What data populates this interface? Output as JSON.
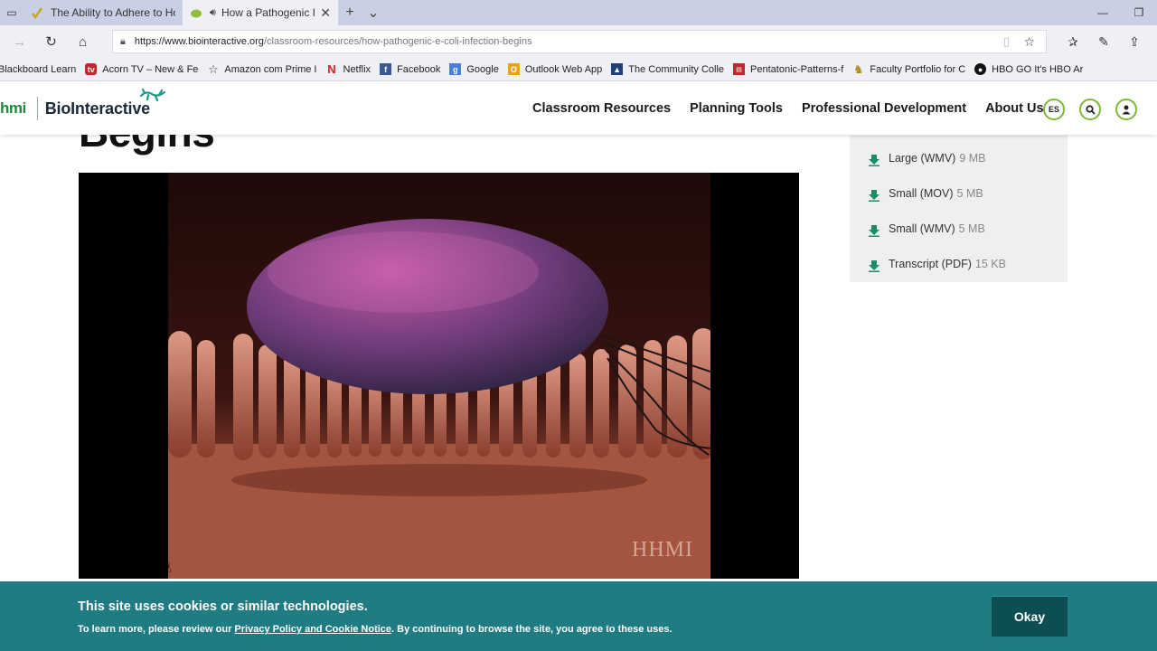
{
  "browser": {
    "tabs": [
      {
        "title": "The Ability to Adhere to Ho",
        "active": false
      },
      {
        "title": "How a Pathogenic I",
        "active": true
      }
    ],
    "url_host": "https://www.biointeractive.org",
    "url_path": "/classroom-resources/how-pathogenic-e-coli-infection-begins",
    "bookmarks": [
      {
        "label": "Blackboard Learn",
        "icon": "blackboard-icon",
        "color": ""
      },
      {
        "label": "Acorn TV – New & Fe",
        "icon": "acorn-tv-icon",
        "color": "#c0282d"
      },
      {
        "label": "Amazon com  Prime I",
        "icon": "star-icon",
        "color": ""
      },
      {
        "label": "Netflix",
        "icon": "netflix-icon",
        "color": "#d81f26"
      },
      {
        "label": "Facebook",
        "icon": "facebook-icon",
        "color": "#3b5998"
      },
      {
        "label": "Google",
        "icon": "google-icon",
        "color": "#4a7fd8"
      },
      {
        "label": "Outlook Web App",
        "icon": "outlook-icon",
        "color": "#e8a317"
      },
      {
        "label": "The Community Colle",
        "icon": "college-icon",
        "color": "#1d3f7a"
      },
      {
        "label": "Pentatonic-Patterns-f",
        "icon": "pdf-icon",
        "color": "#c0282d"
      },
      {
        "label": "Faculty Portfolio for C",
        "icon": "portfolio-icon",
        "color": "#b68a1a"
      },
      {
        "label": "HBO GO  It's HBO  Ar",
        "icon": "hbo-icon",
        "color": "#111111"
      }
    ]
  },
  "site": {
    "logo_hhmi": "hmi",
    "logo_name": "BioInteractive",
    "nav": [
      "Classroom Resources",
      "Planning Tools",
      "Professional Development",
      "About Us"
    ],
    "lang_button": "ES",
    "accent_color": "#7eb83a"
  },
  "page": {
    "title_fragment": "Begins",
    "video_watermark": "HHMI",
    "downloads": [
      {
        "label": "Large (WMV)",
        "size": "9 MB"
      },
      {
        "label": "Small (MOV)",
        "size": "5 MB"
      },
      {
        "label": "Small (WMV)",
        "size": "5 MB"
      },
      {
        "label": "Transcript (PDF)",
        "size": "15 KB"
      }
    ]
  },
  "cookie": {
    "title": "This site uses cookies or similar technologies.",
    "text_before": "To learn more, please review our ",
    "link": "Privacy Policy and Cookie Notice",
    "text_after": ". By continuing to browse the site, you agree to these uses.",
    "button": "Okay",
    "color": "#1f7c82"
  }
}
